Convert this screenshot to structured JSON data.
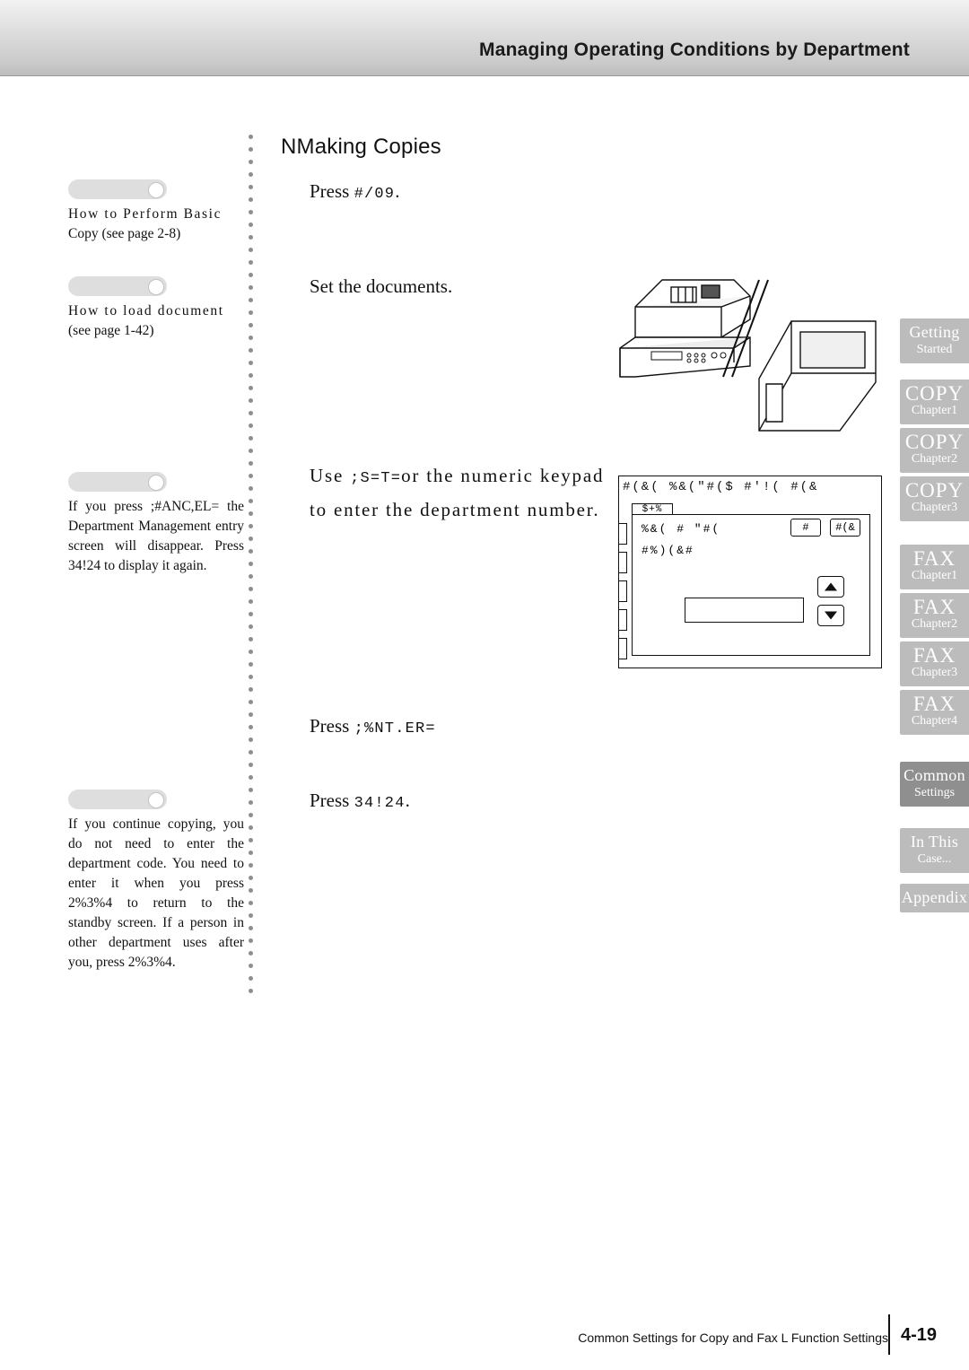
{
  "header": {
    "title": "Managing Operating Conditions by Department"
  },
  "section": {
    "title": "NMaking Copies"
  },
  "steps": [
    {
      "text_before": "Press ",
      "code": "#/09",
      "text_after": "."
    },
    {
      "text_before": "Set the documents.",
      "code": "",
      "text_after": ""
    },
    {
      "text_before": "Use ",
      "code": ";S=T=",
      "text_after": "or the numeric keypad to enter the department number."
    },
    {
      "text_before": "Press ",
      "code": ";%NT.ER=",
      "text_after": ""
    },
    {
      "text_before": "Press ",
      "code": "34!24",
      "text_after": "."
    }
  ],
  "notes": [
    {
      "id": "note-basic-copy",
      "lines": [
        "How to Perform Basic",
        "Copy (see page 2-8)"
      ]
    },
    {
      "id": "note-load-document",
      "lines": [
        "How to load document",
        "(see page 1-42)"
      ]
    },
    {
      "id": "note-cancel",
      "text": "If you press ;#ANC,EL= the Department Management entry screen will disappear. Press 34!24 to display it again."
    },
    {
      "id": "note-continue-copy",
      "text": "If you continue copying, you do not need to enter the department code. You need to enter it when you press 2%3%4 to return to the standby screen. If a person in other department uses after you, press 2%3%4."
    }
  ],
  "lcd": {
    "top_line": "#(&(  %&(\"#($  #'!( #(&",
    "tab_label": "$+%",
    "row1": "%&(  # \"#(",
    "row2": "#%)(&#",
    "btn1": "#",
    "btn2": "#(&"
  },
  "tabs": [
    {
      "label": "Getting",
      "sub": "Started",
      "style": "gray2"
    },
    {
      "label": "COPY",
      "sub": "Chapter1",
      "style": "gray2"
    },
    {
      "label": "COPY",
      "sub": "Chapter2",
      "style": "gray2"
    },
    {
      "label": "COPY",
      "sub": "Chapter3",
      "style": "gray2"
    },
    {
      "label": "FAX",
      "sub": "Chapter1",
      "style": "gray2"
    },
    {
      "label": "FAX",
      "sub": "Chapter2",
      "style": "gray2"
    },
    {
      "label": "FAX",
      "sub": "Chapter3",
      "style": "gray2"
    },
    {
      "label": "FAX",
      "sub": "Chapter4",
      "style": "gray2"
    },
    {
      "label": "Common",
      "sub": "Settings",
      "style": "dark"
    },
    {
      "label": "In This",
      "sub": "Case...",
      "style": "gray2"
    },
    {
      "label": "Appendix",
      "sub": "",
      "style": "gray2"
    }
  ],
  "footer": {
    "text": "Common Settings for Copy and Fax  L Function Settings",
    "page": "4-19"
  }
}
